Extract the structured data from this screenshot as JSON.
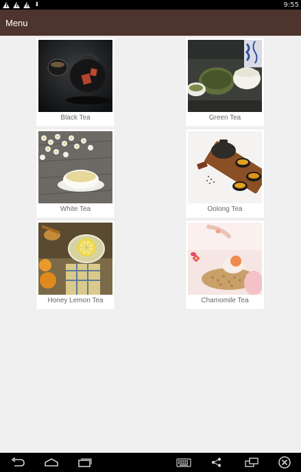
{
  "status_bar": {
    "time": "9:55",
    "icons": [
      "warning-icon",
      "warning-icon",
      "warning-icon",
      "download-icon"
    ]
  },
  "app_bar": {
    "title": "Menu"
  },
  "menu": {
    "items": [
      {
        "label": "Black Tea",
        "icon": "black-tea-image"
      },
      {
        "label": "Green Tea",
        "icon": "green-tea-image"
      },
      {
        "label": "White Tea",
        "icon": "white-tea-image"
      },
      {
        "label": "Oolong Tea",
        "icon": "oolong-tea-image"
      },
      {
        "label": "Honey Lemon Tea",
        "icon": "honey-lemon-tea-image"
      },
      {
        "label": "Chamomile Tea",
        "icon": "chamomile-tea-image"
      }
    ]
  },
  "nav_bar": {
    "icons": [
      "back-icon",
      "home-icon",
      "recents-icon",
      "keyboard-icon",
      "share-icon",
      "screen-rotate-icon",
      "close-icon"
    ]
  },
  "colors": {
    "app_bar": "#4e342e",
    "background": "#f0f0f0",
    "label": "#666666"
  }
}
